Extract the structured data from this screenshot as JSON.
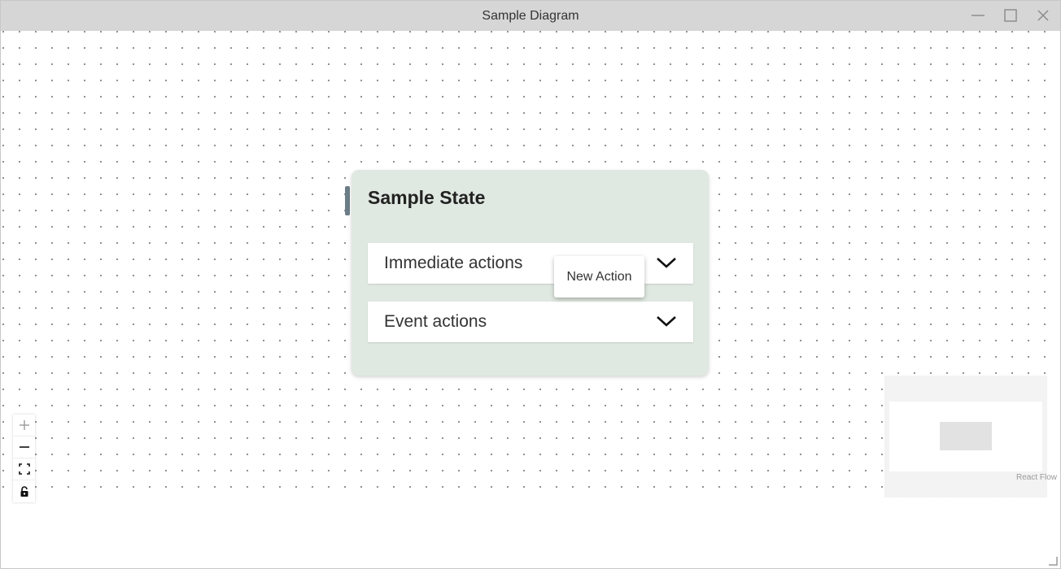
{
  "window": {
    "title": "Sample Diagram",
    "controls": [
      "minimize-icon",
      "maximize-icon",
      "close-icon"
    ]
  },
  "node": {
    "title": "Sample State",
    "background_color": "#e0e9e1",
    "handle_color": "#6b7d86",
    "sections": [
      {
        "label": "Immediate actions",
        "icon": "chevron-down-icon"
      },
      {
        "label": "Event actions",
        "icon": "chevron-down-icon"
      }
    ]
  },
  "tooltip": {
    "text": "New Action"
  },
  "controls": {
    "buttons": [
      "zoom-in-icon",
      "zoom-out-icon",
      "fit-view-icon",
      "lock-icon"
    ]
  },
  "attribution": "React Flow"
}
